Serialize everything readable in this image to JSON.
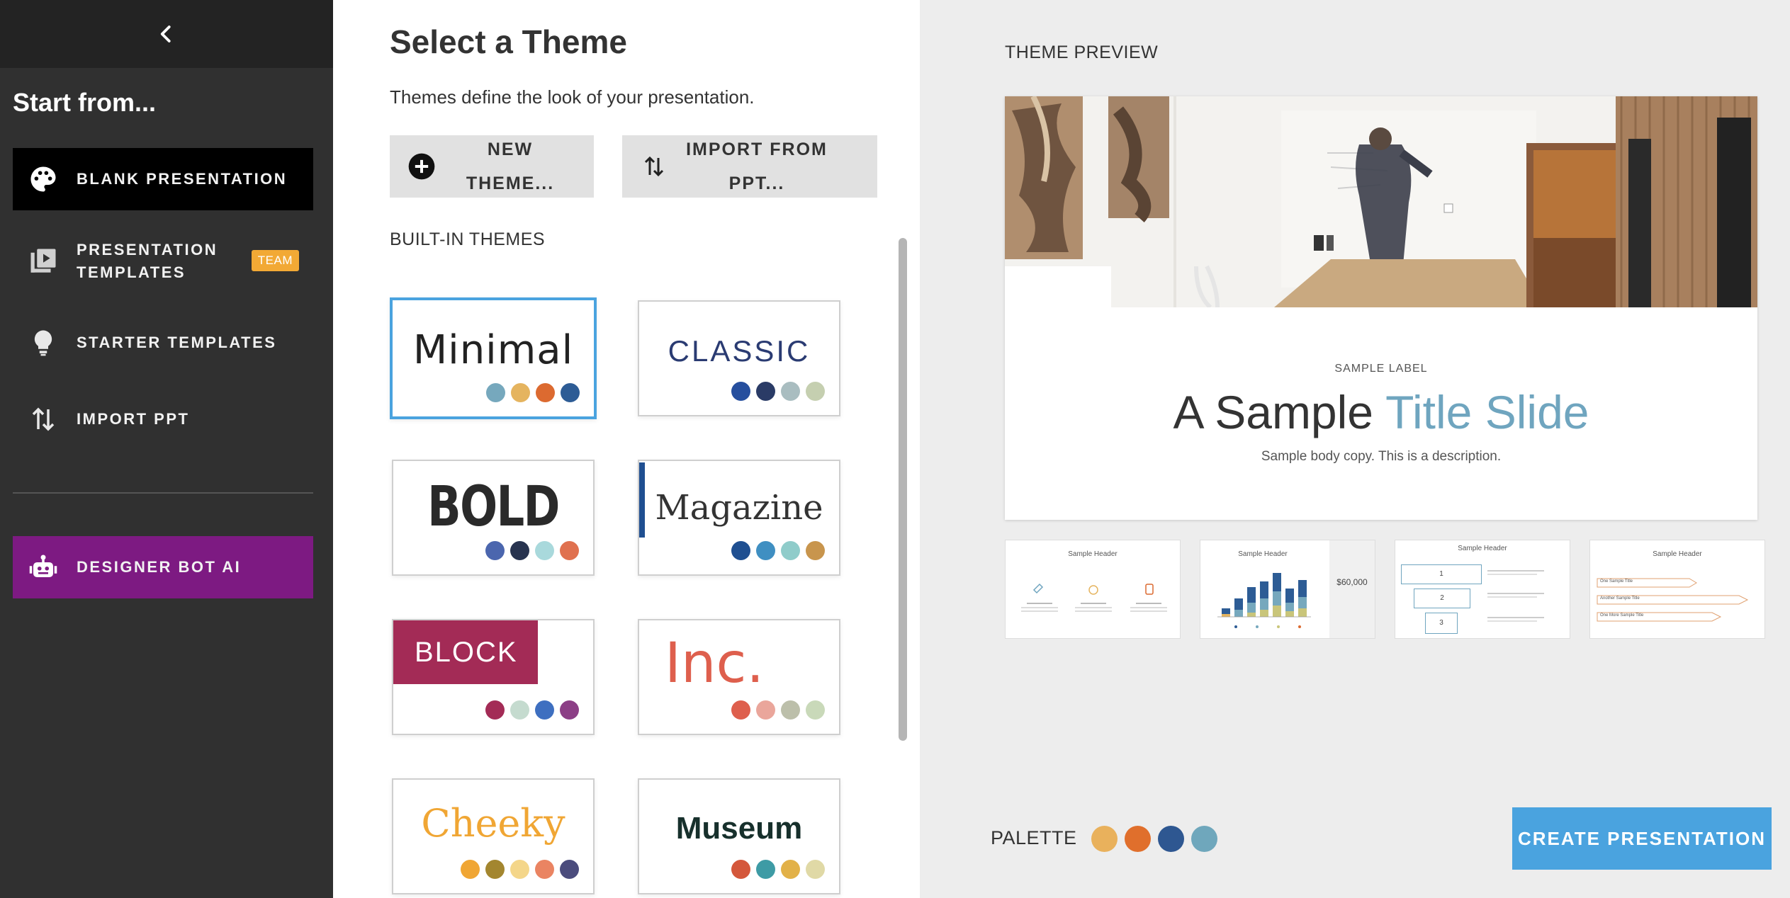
{
  "sidebar": {
    "heading": "Start from...",
    "items": [
      {
        "label": "BLANK PRESENTATION"
      },
      {
        "label": "PRESENTATION TEMPLATES",
        "badge": "TEAM"
      },
      {
        "label": "STARTER TEMPLATES"
      },
      {
        "label": "IMPORT PPT"
      },
      {
        "label": "DESIGNER BOT AI"
      }
    ]
  },
  "main": {
    "title": "Select a Theme",
    "subtitle": "Themes define the look of your presentation.",
    "new_theme_label": "NEW THEME...",
    "import_label": "IMPORT FROM PPT...",
    "builtin_heading": "BUILT-IN THEMES",
    "themes": [
      {
        "name": "Minimal",
        "colors": [
          "#76a8bd",
          "#e5b45f",
          "#dc6a30",
          "#2d5c95"
        ],
        "selected": true
      },
      {
        "name": "CLASSIC",
        "colors": [
          "#264f9e",
          "#2a3b66",
          "#a9bdc0",
          "#c5cfb0"
        ]
      },
      {
        "name": "BOLD",
        "colors": [
          "#4b66ae",
          "#27334f",
          "#a9d9dc",
          "#e0714f"
        ]
      },
      {
        "name": "Magazine",
        "colors": [
          "#1f4f91",
          "#3f8fc2",
          "#8fccca",
          "#c8954d"
        ]
      },
      {
        "name": "BLOCK",
        "colors": [
          "#a32b56",
          "#c5dbcf",
          "#3e6fc0",
          "#8c3f86"
        ]
      },
      {
        "name": "Inc.",
        "colors": [
          "#de5f4d",
          "#eaa69b",
          "#bcbfaa",
          "#c9d9b9"
        ]
      },
      {
        "name": "Cheeky",
        "colors": [
          "#f0a634",
          "#a3862f",
          "#f4d68a",
          "#ea8462",
          "#4b4c7d"
        ]
      },
      {
        "name": "Museum",
        "colors": [
          "#d4573b",
          "#3e9ba5",
          "#e2b148",
          "#e0d9a6"
        ]
      }
    ]
  },
  "preview": {
    "heading": "THEME PREVIEW",
    "sample_label": "SAMPLE LABEL",
    "title_plain": "A Sample ",
    "title_accent": "Title Slide",
    "body": "Sample body copy. This is a description.",
    "thumbnails": [
      {
        "header": "Sample Header"
      },
      {
        "header": "Sample Header",
        "value": "$60,000"
      },
      {
        "header": "Sample Header",
        "steps": [
          "1",
          "2",
          "3"
        ]
      },
      {
        "header": "Sample Header",
        "items": [
          "One Sample Title",
          "Another Sample Title",
          "One More Sample Title"
        ]
      }
    ]
  },
  "footer": {
    "palette_label": "PALETTE",
    "palette": [
      "#e9b15c",
      "#e06f2c",
      "#2e5791",
      "#6fa7bc"
    ],
    "create_label": "CREATE PRESENTATION"
  }
}
